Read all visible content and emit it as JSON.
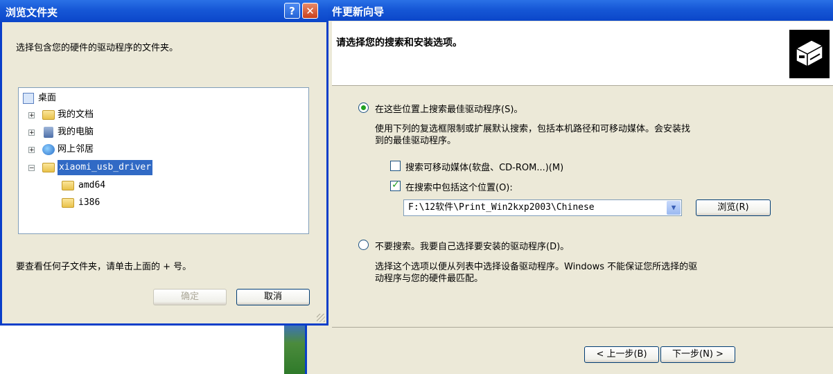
{
  "wizard": {
    "title": "件更新向导",
    "header_text": "请选择您的搜索和安装选项。",
    "option_search": {
      "label": "在这些位置上搜索最佳驱动程序(S)。",
      "desc_line1": "使用下列的复选框限制或扩展默认搜索，包括本机路径和可移动媒体。会安装找",
      "desc_line2": "到的最佳驱动程序。",
      "selected": true
    },
    "checkbox_removable": {
      "label": "搜索可移动媒体(软盘、CD-ROM...)(M)",
      "checked": false
    },
    "checkbox_include": {
      "label": "在搜索中包括这个位置(O):",
      "checked": true
    },
    "path_value": "F:\\12软件\\Print_Win2kxp2003\\Chinese",
    "browse_button": "浏览(R)",
    "option_nosearch": {
      "label": "不要搜索。我要自己选择要安装的驱动程序(D)。",
      "desc_line1": "选择这个选项以便从列表中选择设备驱动程序。Windows 不能保证您所选择的驱",
      "desc_line2": "动程序与您的硬件最匹配。",
      "selected": false
    },
    "back_button": "< 上一步(B)",
    "next_button": "下一步(N) >"
  },
  "browse_dialog": {
    "title": "浏览文件夹",
    "help_glyph": "?",
    "close_glyph": "✕",
    "description": "选择包含您的硬件的驱动程序的文件夹。",
    "tree": {
      "root": "桌面",
      "items": [
        "我的文档",
        "我的电脑",
        "网上邻居",
        "xiaomi_usb_driver"
      ],
      "subitems": [
        "amd64",
        "i386"
      ],
      "selected": "xiaomi_usb_driver"
    },
    "hint": "要查看任何子文件夹，请单击上面的 + 号。",
    "ok_button": "确定",
    "cancel_button": "取消"
  },
  "colors": {
    "titlebar": "#0b46c9",
    "dialog_bg": "#ece9d8",
    "selection": "#316ac5",
    "check_green": "#21a121"
  }
}
